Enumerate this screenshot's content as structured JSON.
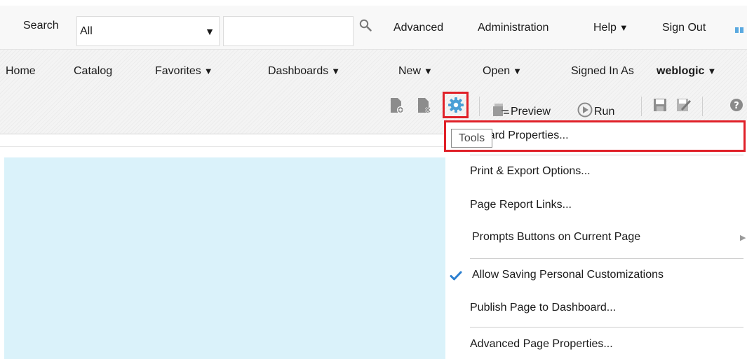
{
  "topbar": {
    "search_label": "Search",
    "search_scope": "All",
    "search_value": "",
    "advanced": "Advanced",
    "administration": "Administration",
    "help": "Help",
    "sign_out": "Sign Out"
  },
  "nav": {
    "home": "Home",
    "catalog": "Catalog",
    "favorites": "Favorites",
    "dashboards": "Dashboards",
    "new": "New",
    "open": "Open",
    "signed_in_as": "Signed In As",
    "user": "weblogic"
  },
  "toolbar": {
    "preview": "Preview",
    "run": "Run",
    "tooltip": "Tools"
  },
  "menu": {
    "items": [
      {
        "label": "hboard Properties..."
      },
      {
        "label": "Print & Export Options..."
      },
      {
        "label": "Page Report Links..."
      },
      {
        "label": "Prompts Buttons on Current Page"
      },
      {
        "label": "Allow Saving Personal Customizations",
        "checked": true
      },
      {
        "label": "Publish Page to Dashboard..."
      },
      {
        "label": "Advanced Page Properties..."
      }
    ]
  },
  "colors": {
    "highlight": "#e02028",
    "canvas": "#daf2fa",
    "gear": "#4a9fd6",
    "check": "#2b7fd0"
  },
  "icons": [
    "chevron-down-icon",
    "search-icon",
    "new-page-icon",
    "delete-page-icon",
    "gear-icon",
    "preview-icon",
    "run-icon",
    "save-icon",
    "save-as-icon",
    "help-icon",
    "checkmark-icon",
    "submenu-arrow-icon"
  ]
}
